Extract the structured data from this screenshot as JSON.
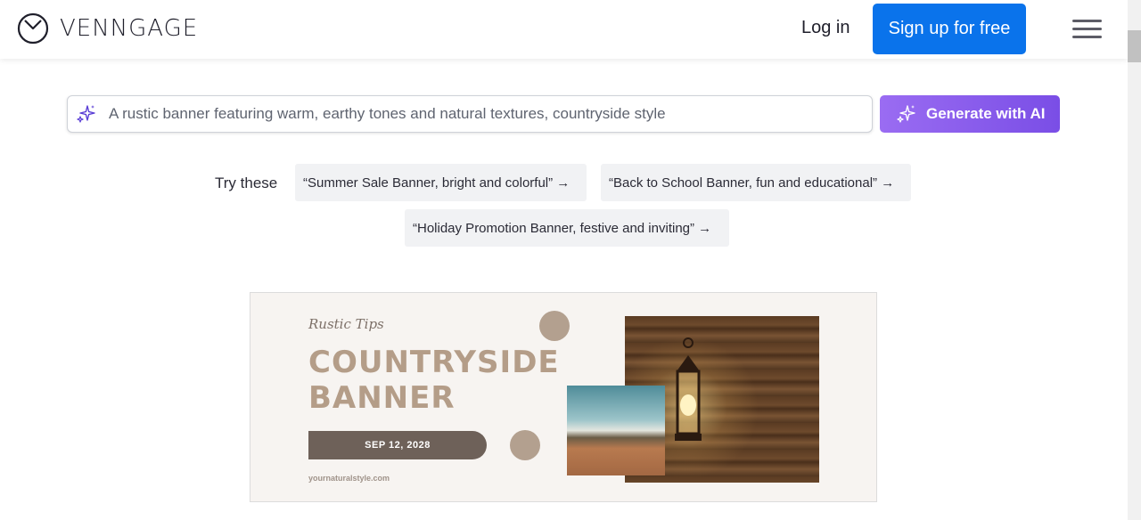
{
  "header": {
    "brand": "VENNGAGE",
    "login_label": "Log in",
    "signup_label": "Sign up for free"
  },
  "search": {
    "placeholder": "A rustic banner featuring warm, earthy tones and natural textures, countryside style",
    "generate_label": "Generate with AI"
  },
  "suggestions": {
    "label": "Try these",
    "items": [
      "“Summer Sale Banner, bright and colorful” →",
      "“Back to School Banner, fun and educational” →",
      "“Holiday Promotion Banner, festive and inviting” →"
    ]
  },
  "preview": {
    "tag": "Rustic Tips",
    "title_line1": "COUNTRYSIDE",
    "title_line2": "BANNER",
    "date": "SEP 12, 2028",
    "url": "yournaturalstyle.com"
  },
  "colors": {
    "primary_button": "#0a73eb",
    "ai_button": "#8a5cf0",
    "banner_title": "#b49d88",
    "banner_bg": "#f7f4f1"
  },
  "icons": {
    "logo": "venngage-clock-logo",
    "search": "sparkle-icon",
    "generate": "sparkle-icon",
    "menu": "hamburger-icon"
  }
}
